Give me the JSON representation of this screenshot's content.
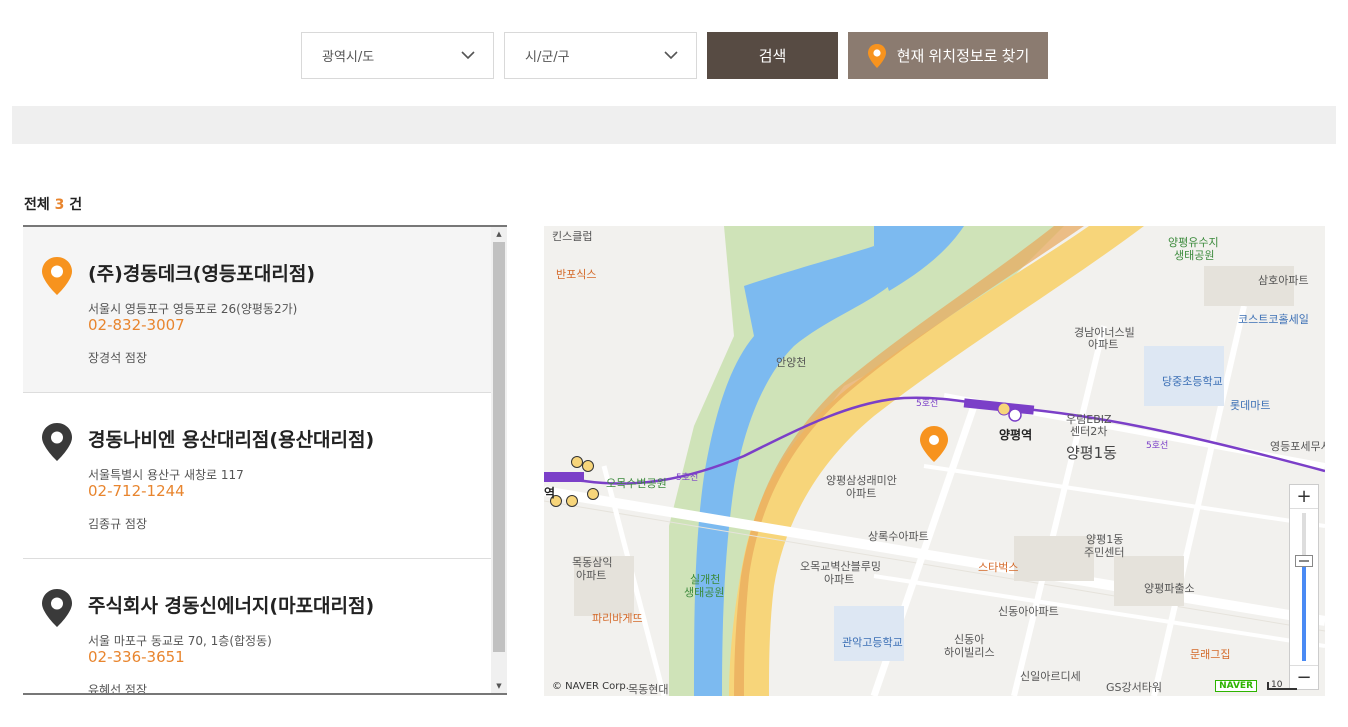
{
  "search": {
    "province_label": "광역시/도",
    "city_label": "시/군/구",
    "search_button": "검색",
    "locate_button": "현재 위치정보로 찾기"
  },
  "summary": {
    "prefix": "전체",
    "count": "3",
    "suffix": "건"
  },
  "stores": [
    {
      "name": "(주)경동데크(영등포대리점)",
      "address": "서울시 영등포구 영등포로 26(양평동2가)",
      "phone": "02-832-3007",
      "manager": "장경석 점장",
      "active": true
    },
    {
      "name": "경동나비엔 용산대리점(용산대리점)",
      "address": "서울특별시 용산구 새창로 117",
      "phone": "02-712-1244",
      "manager": "김종규 점장",
      "active": false
    },
    {
      "name": "주식회사 경동신에너지(마포대리점)",
      "address": "서울 마포구 동교로 70, 1층(합정동)",
      "phone": "02-336-3651",
      "manager": "유혜선 점장",
      "active": false
    }
  ],
  "map": {
    "labels": {
      "kids": "킨스클럽",
      "banpo": "반포식스",
      "yangpyeong_wet": "양평유수지",
      "yangpyeong_wet2": "생태공원",
      "samho": "삼호아파트",
      "costco": "코스트코홀세일",
      "anyangcheon": "안양천",
      "gyeongnam": "경남아너스빌",
      "gyeongnam2": "아파트",
      "dangsan_school": "당중초등학교",
      "lotte": "롯데마트",
      "ebiz": "우림EBIZ",
      "ebiz2": "센터2차",
      "station": "양평역",
      "dong": "양평1동",
      "tax": "영등포세무서",
      "line5a": "5호선",
      "line5b": "5호선",
      "line5c": "5호선",
      "omok_park": "오목수변공원",
      "samsung": "양평삼성래미안",
      "samsung2": "아파트",
      "sangrok": "상록수아파트",
      "community": "양평1동",
      "community2": "주민센터",
      "mokdong": "목동삼익",
      "mokdong2": "아파트",
      "silgae": "실개천",
      "silgae2": "생태공원",
      "omokgyo": "오목교벽산블루밍",
      "omokgyo2": "아파트",
      "starbucks": "스타벅스",
      "post": "양평파출소",
      "sindong": "신동아아파트",
      "paris": "파리바게뜨",
      "gwanak": "관악고등학교",
      "sindong_hv": "신동아",
      "sindong_hv2": "하이빌리스",
      "mungrae": "문래그집",
      "sinil": "신일아르디세",
      "gs": "GS강서타워",
      "mokdong_hd": "목동현대",
      "yeok": "역"
    },
    "copyright": "© NAVER Corp.",
    "naver": "NAVER",
    "scale": "10",
    "zoom_in": "+",
    "zoom_out": "−"
  },
  "colors": {
    "accent": "#e8852e",
    "dark_button": "#574b43",
    "locate_button": "#8b7b70",
    "line5": "#7b3fc8",
    "river": "#7cbaf0"
  },
  "icons": {
    "location_pin": "map-pin-icon",
    "chevron": "chevron-down-icon"
  }
}
